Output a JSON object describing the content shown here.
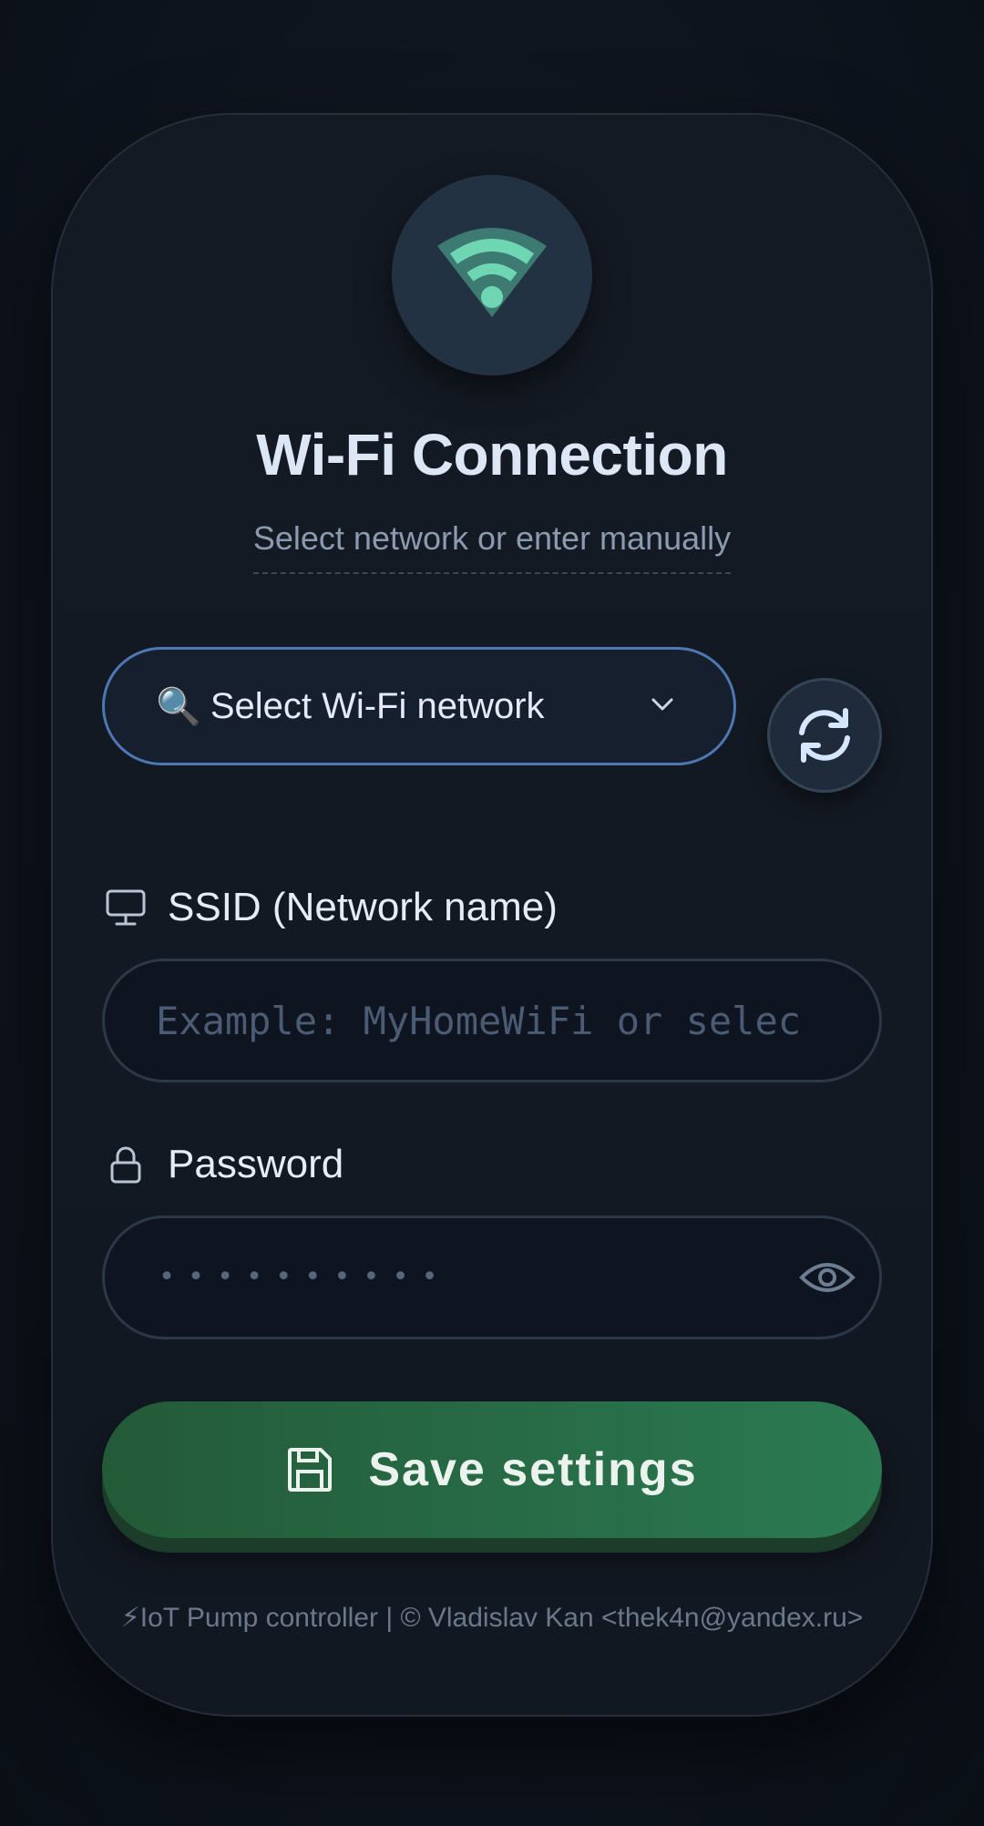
{
  "header": {
    "title": "Wi-Fi Connection",
    "subtitle": "Select network or enter manually"
  },
  "network_select": {
    "icon": "🔍",
    "label": "Select Wi-Fi network"
  },
  "refresh": {
    "icon": "refresh-icon"
  },
  "ssid": {
    "label": "SSID (Network name)",
    "placeholder": "Example: MyHomeWiFi or selec",
    "icon": "monitor-icon"
  },
  "password": {
    "label": "Password",
    "masked": "••••••••••",
    "icon": "lock-icon",
    "toggle_icon": "eye-icon"
  },
  "save": {
    "label": "Save settings",
    "icon": "floppy-disk-icon"
  },
  "footer": {
    "text": "⚡IoT Pump controller | © Vladislav Kan <thek4n@yandex.ru>"
  },
  "colors": {
    "accent_wifi": "#6fd6b4",
    "select_border": "#4f78b3",
    "save_button": "#2b7a52"
  }
}
